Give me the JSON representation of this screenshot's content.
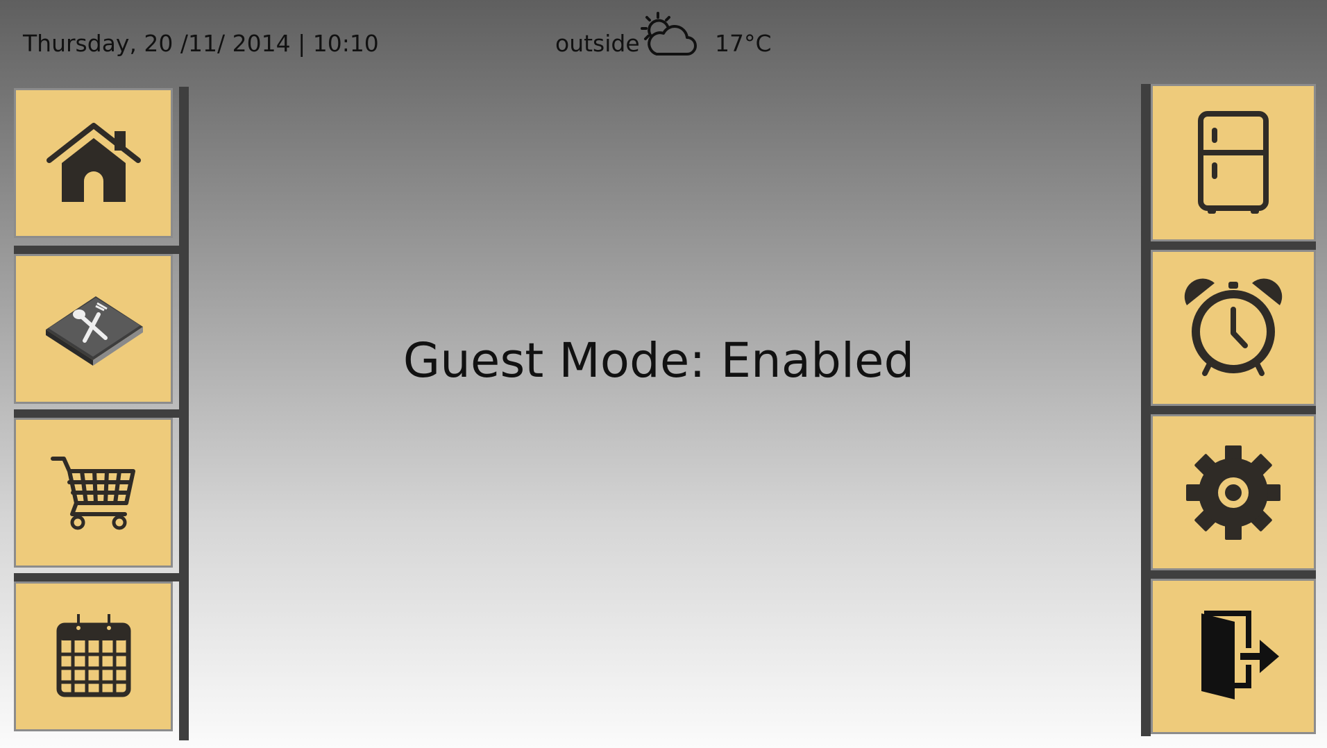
{
  "header": {
    "datetime": "Thursday, 20 /11/ 2014 | 10:10",
    "outside_label": "outside",
    "weather_icon": "partly-cloudy-icon",
    "temperature": "17°C"
  },
  "main": {
    "status": "Guest Mode: Enabled"
  },
  "left_menu": [
    {
      "name": "home",
      "icon": "home-icon"
    },
    {
      "name": "recipes",
      "icon": "recipe-book-icon"
    },
    {
      "name": "shopping",
      "icon": "shopping-cart-icon"
    },
    {
      "name": "calendar",
      "icon": "calendar-icon"
    }
  ],
  "right_menu": [
    {
      "name": "fridge",
      "icon": "fridge-icon"
    },
    {
      "name": "alarm",
      "icon": "alarm-clock-icon"
    },
    {
      "name": "settings",
      "icon": "gear-icon"
    },
    {
      "name": "exit",
      "icon": "exit-door-icon"
    }
  ],
  "colors": {
    "button_bg": "#eecb7b",
    "rail": "#3f3f3f",
    "icon": "#2f2b26"
  }
}
